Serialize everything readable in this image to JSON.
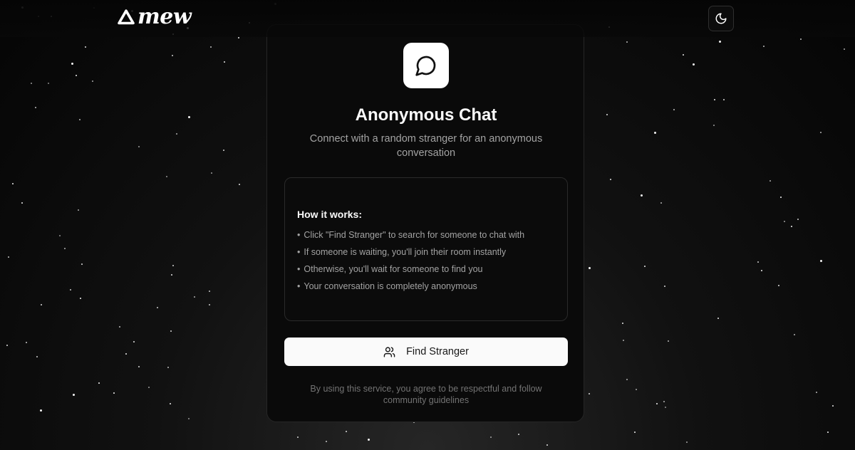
{
  "brand": {
    "name": "mew",
    "icon": "triangle-logo-icon"
  },
  "header": {
    "theme_toggle_icon": "moon-icon"
  },
  "card": {
    "icon": "message-circle-icon",
    "title": "Anonymous Chat",
    "subtitle": "Connect with a random stranger for an anonymous conversation",
    "how_it_works": {
      "title": "How it works:",
      "items": [
        "Click \"Find Stranger\" to search for someone to chat with",
        "If someone is waiting, you'll join their room instantly",
        "Otherwise, you'll wait for someone to find you",
        "Your conversation is completely anonymous"
      ]
    },
    "find_button": {
      "label": "Find Stranger",
      "icon": "users-icon"
    },
    "disclaimer": "By using this service, you agree to be respectful and follow community guidelines"
  },
  "colors": {
    "background": "#050505",
    "card_background": "#0a0a0a",
    "card_border": "#262626",
    "button_background": "#fafafa",
    "text_primary": "#fafafa",
    "text_secondary": "#a3a3a3",
    "text_muted": "#737373"
  }
}
